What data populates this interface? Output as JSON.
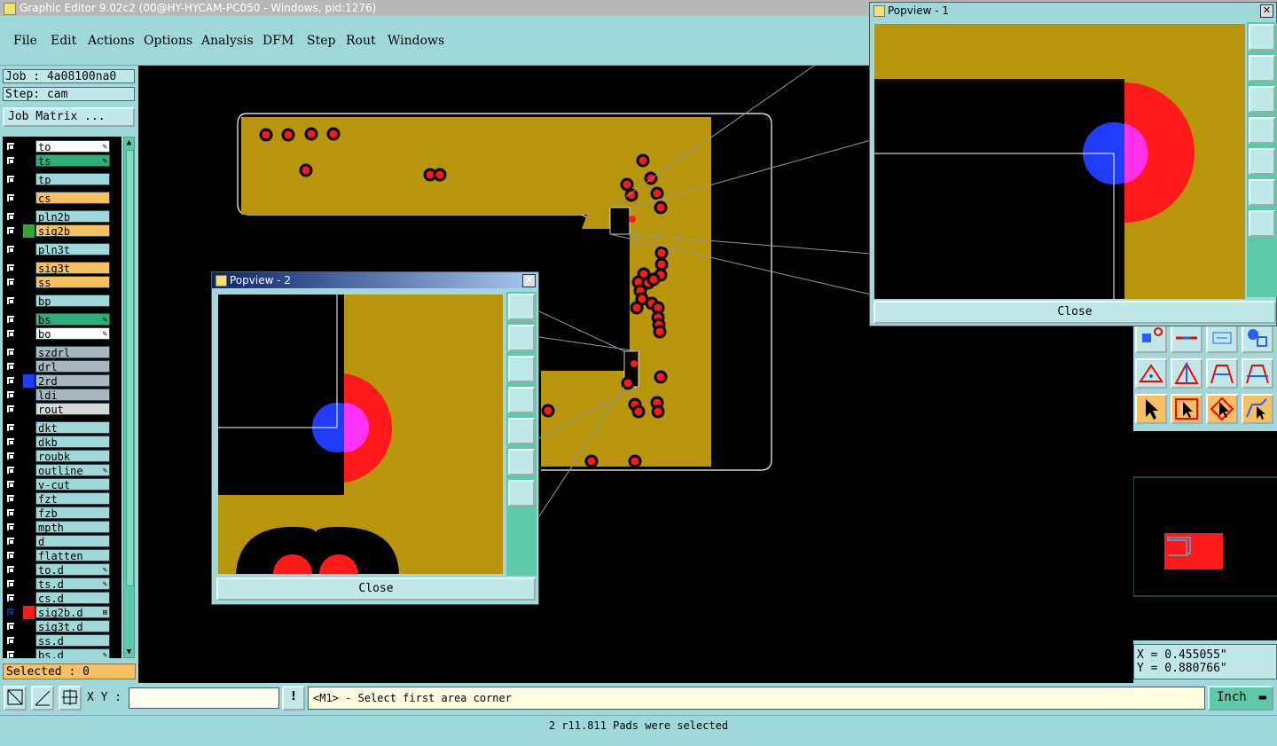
{
  "window": {
    "title": "Graphic Editor 9.02c2 (00@HY-HYCAM-PC050 - Windows, pid:1276)"
  },
  "menu": [
    {
      "label": "File"
    },
    {
      "label": "Edit"
    },
    {
      "label": "Actions"
    },
    {
      "label": "Options"
    },
    {
      "label": "Analysis"
    },
    {
      "label": "DFM"
    },
    {
      "label": "Step"
    },
    {
      "label": "Rout"
    },
    {
      "label": "Windows"
    }
  ],
  "job": {
    "job_label": "Job : 4a08100na0",
    "step_label": "Step: cam",
    "matrix_button": "Job Matrix ..."
  },
  "layers": [
    {
      "name": "to",
      "color": "#ffffff",
      "mark": "✎"
    },
    {
      "name": "ts",
      "color": "#2fae7a",
      "mark": "✎"
    },
    {
      "name": "tp",
      "color": "#9fd8d8",
      "mark": ""
    },
    {
      "name": "cs",
      "color": "#f7c060",
      "mark": ""
    },
    {
      "name": "pln2b",
      "color": "#9fd8d8",
      "mark": ""
    },
    {
      "name": "sig2b",
      "color": "#f7c060",
      "mark": "",
      "swatch": "#3aa03a"
    },
    {
      "name": "pln3t",
      "color": "#9fd8d8",
      "mark": ""
    },
    {
      "name": "sig3t",
      "color": "#f7c060",
      "mark": ""
    },
    {
      "name": "ss",
      "color": "#f7c060",
      "mark": ""
    },
    {
      "name": "bp",
      "color": "#9fd8d8",
      "mark": ""
    },
    {
      "name": "bs",
      "color": "#2fae7a",
      "mark": "✎"
    },
    {
      "name": "bo",
      "color": "#ffffff",
      "mark": "✎"
    },
    {
      "name": "szdrl",
      "color": "#a8b8c0",
      "mark": ""
    },
    {
      "name": "drl",
      "color": "#a8b8c0",
      "mark": ""
    },
    {
      "name": "2rd",
      "color": "#a8b8c0",
      "mark": "",
      "swatch": "#1f3cff"
    },
    {
      "name": "ldi",
      "color": "#a8b8c0",
      "mark": ""
    },
    {
      "name": "rout",
      "color": "#d8d8d8",
      "mark": ""
    },
    {
      "name": "dkt",
      "color": "#9fd8d8",
      "mark": ""
    },
    {
      "name": "dkb",
      "color": "#9fd8d8",
      "mark": ""
    },
    {
      "name": "roubk",
      "color": "#9fd8d8",
      "mark": ""
    },
    {
      "name": "outline",
      "color": "#9fd8d8",
      "mark": "✎"
    },
    {
      "name": "v-cut",
      "color": "#9fd8d8",
      "mark": ""
    },
    {
      "name": "fzt",
      "color": "#9fd8d8",
      "mark": ""
    },
    {
      "name": "fzb",
      "color": "#9fd8d8",
      "mark": ""
    },
    {
      "name": "mpth",
      "color": "#9fd8d8",
      "mark": ""
    },
    {
      "name": "d",
      "color": "#9fd8d8",
      "mark": ""
    },
    {
      "name": "flatten",
      "color": "#9fd8d8",
      "mark": ""
    },
    {
      "name": "to.d",
      "color": "#9fd8d8",
      "mark": "✎"
    },
    {
      "name": "ts.d",
      "color": "#9fd8d8",
      "mark": "✎"
    },
    {
      "name": "cs.d",
      "color": "#9fd8d8",
      "mark": ""
    },
    {
      "name": "sig2b.d",
      "color": "#9fd8d8",
      "mark": "⊞",
      "swatch": "#ff1a1a",
      "active": true
    },
    {
      "name": "sig3t.d",
      "color": "#9fd8d8",
      "mark": ""
    },
    {
      "name": "ss.d",
      "color": "#9fd8d8",
      "mark": ""
    },
    {
      "name": "bs.d",
      "color": "#9fd8d8",
      "mark": "✎"
    }
  ],
  "selected_label": "Selected : 0",
  "popview1": {
    "title": "Popview - 1",
    "close_label": "Close"
  },
  "popview2": {
    "title": "Popview - 2",
    "close_label": "Close"
  },
  "coords": {
    "x": "X = 0.455055\"",
    "y": "Y = 0.880766\""
  },
  "command": {
    "xy_label": "X Y :",
    "xy_value": "",
    "prompt": "<M1> - Select first area corner",
    "units": "Inch"
  },
  "status": "2 r11.811 Pads were selected",
  "colors": {
    "copper": "#b8950a",
    "pad": "#ff1a1a",
    "drill": "#1f3cff",
    "overlap": "#ff33ff",
    "accent": "#9fd8d8"
  }
}
